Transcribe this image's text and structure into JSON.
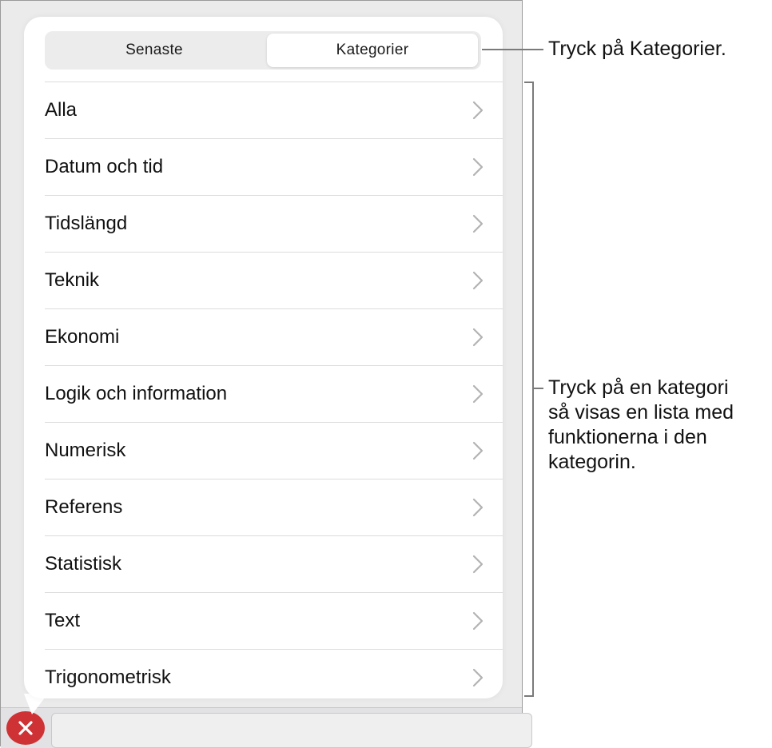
{
  "segmented_control": {
    "tabs": [
      {
        "label": "Senaste",
        "selected": false
      },
      {
        "label": "Kategorier",
        "selected": true
      }
    ]
  },
  "categories": [
    {
      "label": "Alla"
    },
    {
      "label": "Datum och tid"
    },
    {
      "label": "Tidslängd"
    },
    {
      "label": "Teknik"
    },
    {
      "label": "Ekonomi"
    },
    {
      "label": "Logik och information"
    },
    {
      "label": "Numerisk"
    },
    {
      "label": "Referens"
    },
    {
      "label": "Statistisk"
    },
    {
      "label": "Text"
    },
    {
      "label": "Trigonometrisk"
    }
  ],
  "callouts": {
    "tap_categories": "Tryck på Kategorier.",
    "tap_category_lines": [
      "Tryck på en kategori",
      "så visas en lista med",
      "funktionerna i den",
      "kategorin."
    ]
  },
  "icons": {
    "row_chevron": "chevron-right-icon",
    "cancel": "close-icon"
  },
  "colors": {
    "cancel_button": "#cf3235",
    "chevron": "#b3b3b3"
  }
}
